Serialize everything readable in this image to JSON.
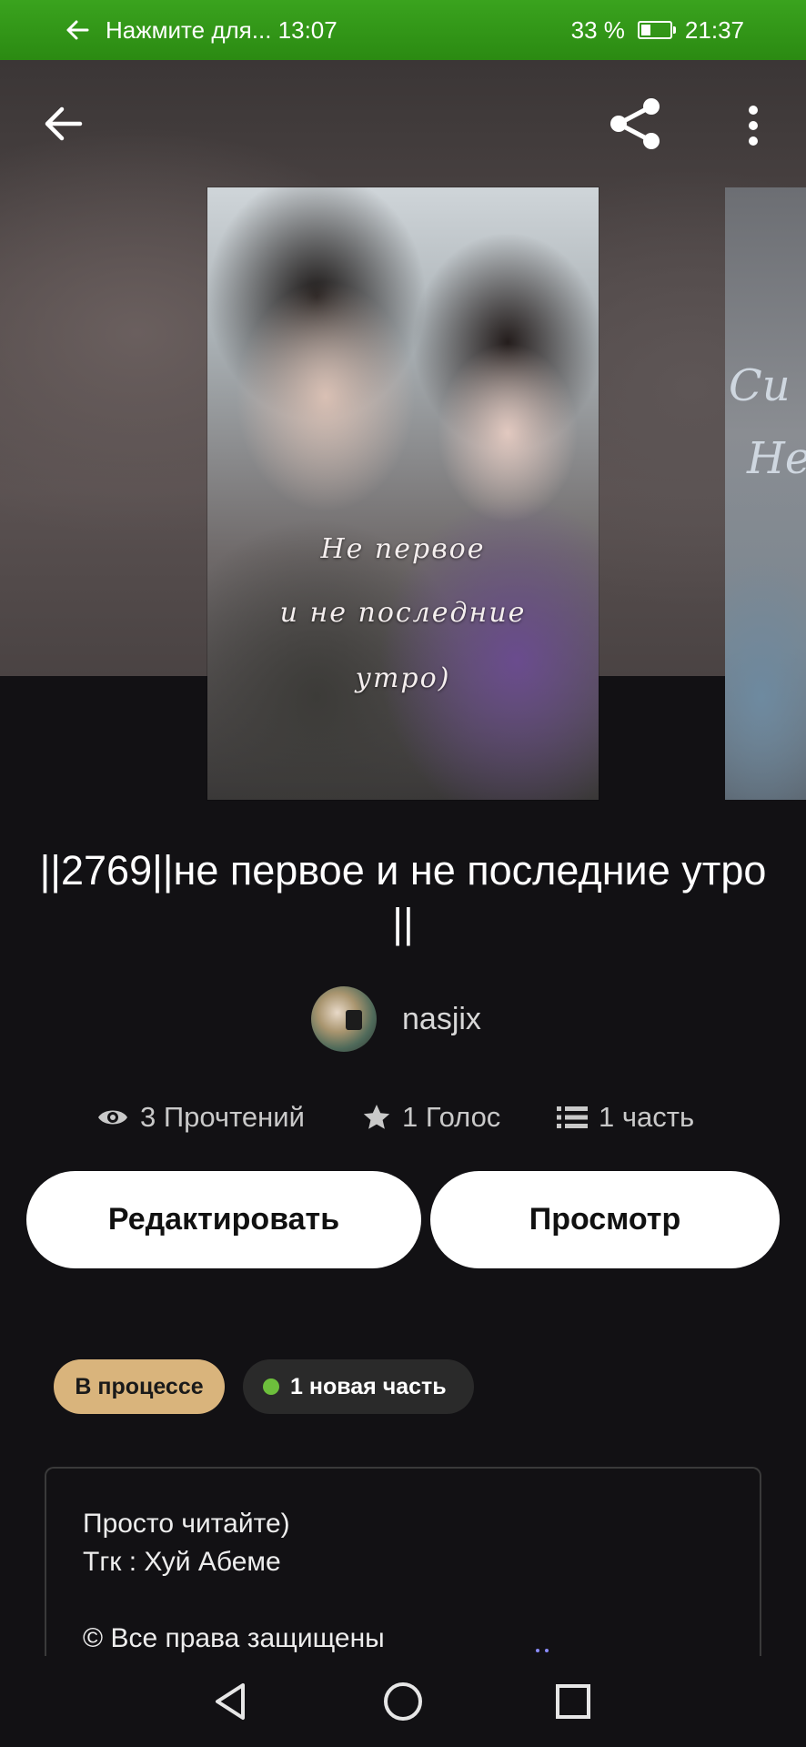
{
  "status_bar": {
    "notification": "Нажмите для... 13:07",
    "battery": "33 %",
    "battery_level": 0.33,
    "time": "21:37"
  },
  "header": {
    "back_icon": "arrow-left-icon",
    "share_icon": "share-icon",
    "more_icon": "more-vertical-icon"
  },
  "cover": {
    "text_lines": [
      "Не первое",
      "и не последние",
      "утро)"
    ],
    "next_cover_text": [
      "Си",
      "Не"
    ]
  },
  "story": {
    "title": "||2769||не первое и не последние утро ||",
    "author": "nasjix"
  },
  "stats": {
    "reads": "3 Прочтений",
    "votes": "1 Голос",
    "parts": "1 часть"
  },
  "actions": {
    "edit_label": "Редактировать",
    "view_label": "Просмотр"
  },
  "badges": {
    "status": "В процессе",
    "new_part": "1 новая часть",
    "status_color": "#d9b47c",
    "new_dot_color": "#6dbf3c"
  },
  "description": {
    "line1": "Просто читайте)",
    "line2": "Тгк : Хуй Абеме",
    "line3": "© Все права защищены"
  },
  "nav": {
    "back_icon": "triangle-back-icon",
    "home_icon": "circle-home-icon",
    "recents_icon": "square-recents-icon"
  }
}
